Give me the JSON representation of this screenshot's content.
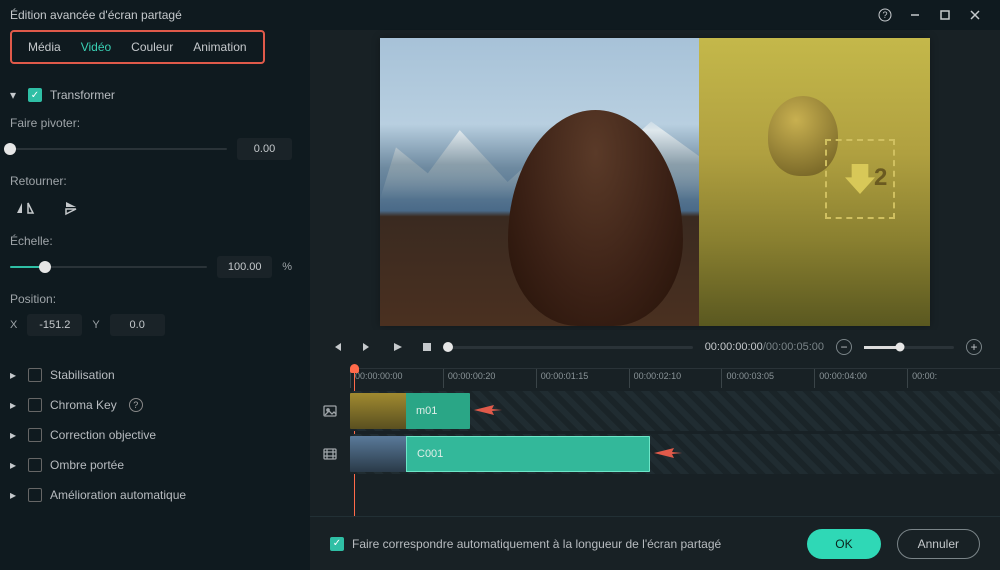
{
  "title": "Édition avancée d'écran partagé",
  "tabs": {
    "media": "Média",
    "video": "Vidéo",
    "color": "Couleur",
    "animation": "Animation"
  },
  "transform": {
    "label": "Transformer",
    "rotate_label": "Faire pivoter:",
    "rotate_value": "0.00",
    "flip_label": "Retourner:",
    "scale_label": "Échelle:",
    "scale_value": "100.00",
    "scale_unit": "%",
    "position_label": "Position:",
    "x_label": "X",
    "x_value": "-151.2",
    "y_label": "Y",
    "y_value": "0.0"
  },
  "sections": {
    "stabilisation": "Stabilisation",
    "chroma": "Chroma Key",
    "correction": "Correction objective",
    "ombre": "Ombre portée",
    "auto": "Amélioration automatique"
  },
  "playback": {
    "current": "00:00:00:00",
    "total": "00:00:05:00"
  },
  "ruler": [
    "00:00:00:00",
    "00:00:00:20",
    "00:00:01:15",
    "00:00:02:10",
    "00:00:03:05",
    "00:00:04:00",
    "00:00:"
  ],
  "clips": {
    "m01": "m01",
    "c001": "C001"
  },
  "arrow_num": "2",
  "footer": {
    "match_label": "Faire correspondre automatiquement à la longueur de l'écran partagé",
    "ok": "OK",
    "cancel": "Annuler"
  }
}
